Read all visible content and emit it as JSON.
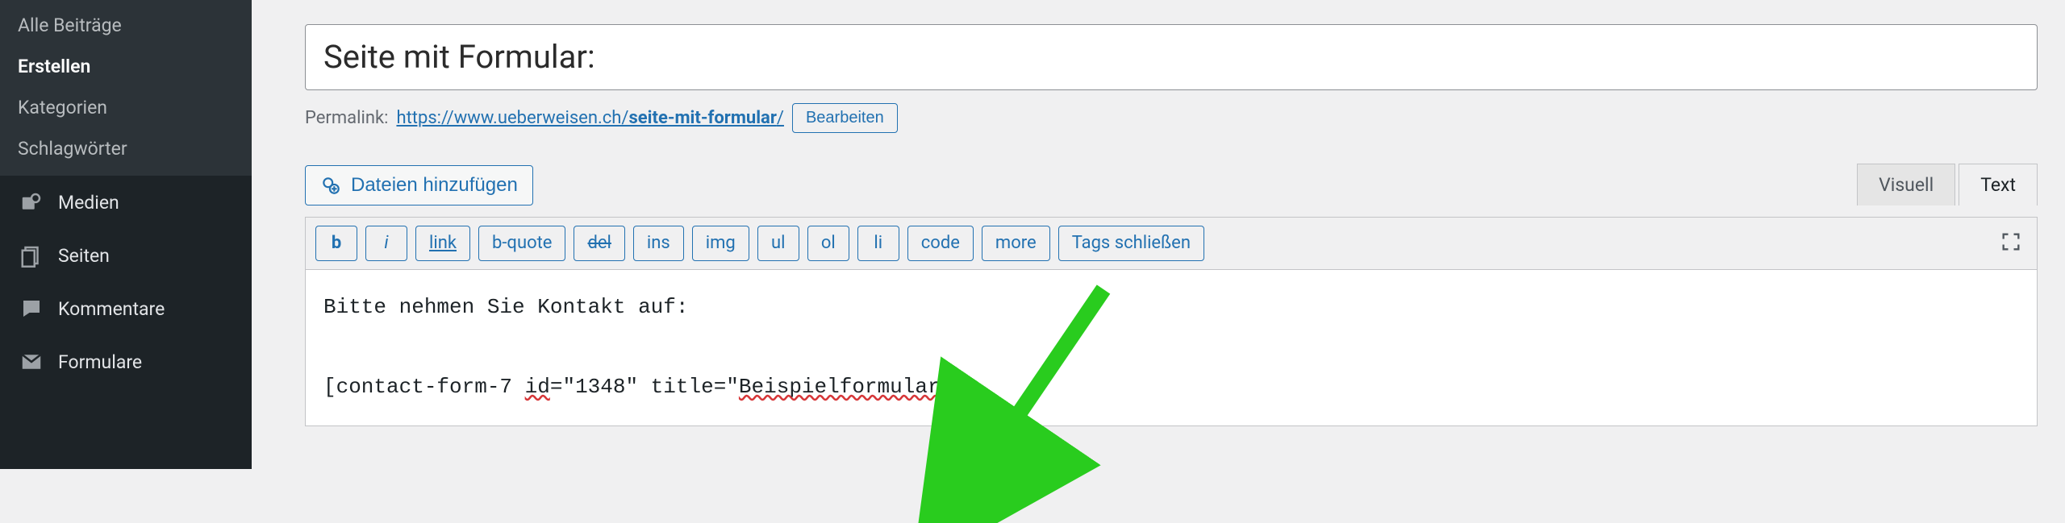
{
  "sidebar": {
    "sub_items": [
      {
        "label": "Alle Beiträge",
        "active": false
      },
      {
        "label": "Erstellen",
        "active": true
      },
      {
        "label": "Kategorien",
        "active": false
      },
      {
        "label": "Schlagwörter",
        "active": false
      }
    ],
    "top_items": [
      {
        "icon": "media-icon",
        "label": "Medien"
      },
      {
        "icon": "pages-icon",
        "label": "Seiten"
      },
      {
        "icon": "comments-icon",
        "label": "Kommentare"
      },
      {
        "icon": "mail-icon",
        "label": "Formulare"
      }
    ]
  },
  "title": "Seite mit Formular:",
  "permalink": {
    "label": "Permalink:",
    "base": "https://www.ueberweisen.ch/",
    "slug": "seite-mit-formular",
    "trail": "/",
    "edit_label": "Bearbeiten"
  },
  "media_button": "Dateien hinzufügen",
  "tabs": {
    "visual": "Visuell",
    "text": "Text",
    "active": "text"
  },
  "toolbar": {
    "b": "b",
    "i": "i",
    "link": "link",
    "bquote": "b-quote",
    "del": "del",
    "ins": "ins",
    "img": "img",
    "ul": "ul",
    "ol": "ol",
    "li": "li",
    "code": "code",
    "more": "more",
    "close": "Tags schließen"
  },
  "content": {
    "line1": "Bitte nehmen Sie Kontakt auf:",
    "line2_prefix": "[contact-form-7 ",
    "line2_id_key": "id",
    "line2_id_rest": "=\"1348\" title=\"",
    "line2_title_val": "Beispielformular",
    "line2_suffix": "\"]"
  },
  "colors": {
    "accent": "#2271b1",
    "arrow": "#29cc1e"
  }
}
